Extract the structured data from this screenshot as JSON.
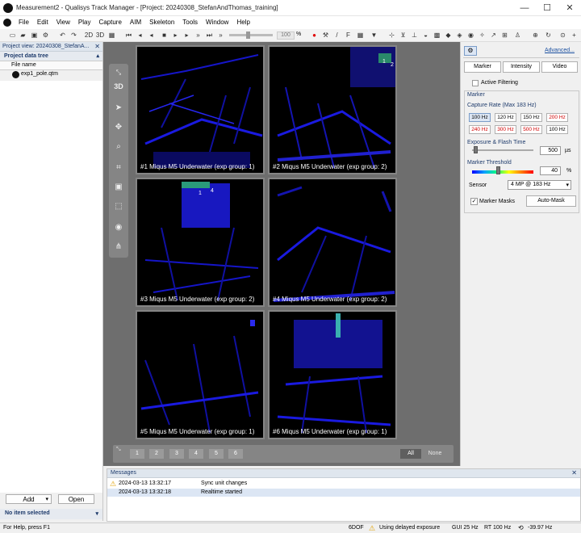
{
  "window": {
    "title": "Measurement2 - Qualisys Track Manager - [Project: 20240308_StefanAndThomas_training]",
    "minimize": "—",
    "maximize": "☐",
    "close": "✕"
  },
  "menu": [
    "File",
    "Edit",
    "View",
    "Play",
    "Capture",
    "AIM",
    "Skeleton",
    "Tools",
    "Window",
    "Help"
  ],
  "toolbar": {
    "label_2d": "2D",
    "label_3d": "3D",
    "zoom_value": "100",
    "zoom_unit": "%"
  },
  "project": {
    "view_title": "Project view: 20240308_StefanA...",
    "tree_title": "Project data tree",
    "column_header": "File name",
    "files": [
      "exp1_pole.qtm"
    ],
    "add_label": "Add",
    "open_label": "Open",
    "no_selection": "No item selected"
  },
  "viewer": {
    "mode_3d": "3D",
    "tiles": [
      {
        "label": "#1 Miqus M5 Underwater (exp group: 1)",
        "markers": []
      },
      {
        "label": "#2 Miqus M5 Underwater (exp group: 2)",
        "markers": [
          "1",
          "2"
        ]
      },
      {
        "label": "#3 Miqus M5 Underwater (exp group: 2)",
        "markers": [
          "1",
          "4"
        ]
      },
      {
        "label": "#4 Miqus M5 Underwater (exp group: 2)",
        "markers": []
      },
      {
        "label": "#5 Miqus M5 Underwater (exp group: 1)",
        "markers": []
      },
      {
        "label": "#6 Miqus M5 Underwater (exp group: 1)",
        "markers": []
      }
    ],
    "pages": [
      "1",
      "2",
      "3",
      "4",
      "5",
      "6"
    ],
    "all_label": "All",
    "none_label": "None"
  },
  "settings": {
    "advanced": "Advanced...",
    "tabs": [
      "Marker",
      "Intensity",
      "Video"
    ],
    "active_filtering": "Active Filtering",
    "section_marker": "Marker",
    "capture_rate_label": "Capture Rate (Max 183 Hz)",
    "rates": [
      {
        "label": "100 Hz",
        "state": "selected"
      },
      {
        "label": "120 Hz",
        "state": "normal"
      },
      {
        "label": "150 Hz",
        "state": "normal"
      },
      {
        "label": "200 Hz",
        "state": "warn"
      },
      {
        "label": "240 Hz",
        "state": "warn"
      },
      {
        "label": "300 Hz",
        "state": "warn"
      },
      {
        "label": "500 Hz",
        "state": "warn"
      },
      {
        "label": "100 Hz",
        "state": "normal"
      }
    ],
    "exposure_label": "Exposure & Flash Time",
    "exposure_value": "500",
    "exposure_unit": "µs",
    "exposure_level": 0.02,
    "threshold_label": "Marker Threshold",
    "threshold_value": "40",
    "threshold_unit": "%",
    "threshold_level": 0.4,
    "sensor_label": "Sensor",
    "sensor_value": "4 MP @ 183 Hz",
    "marker_masks": "Marker Masks",
    "auto_mask": "Auto-Mask"
  },
  "messages": {
    "title": "Messages",
    "rows": [
      {
        "time": "2024-03-13 13:32:17",
        "text": "Sync unit changes",
        "icon": "warning-icon"
      },
      {
        "time": "2024-03-13 13:32:18",
        "text": "Realtime started",
        "icon": ""
      }
    ]
  },
  "status": {
    "help": "For Help, press F1",
    "mode": "6DOF",
    "exposure_note": "Using delayed exposure",
    "gui_rate": "GUI 25 Hz",
    "rt_rate": "RT 100 Hz",
    "signal": "-39.97 Hz"
  },
  "colors": {
    "accent": "#1d3a6b",
    "marker_points": "#0000ff",
    "warn_text": "#d00000",
    "highlight": "#dce6f4"
  }
}
